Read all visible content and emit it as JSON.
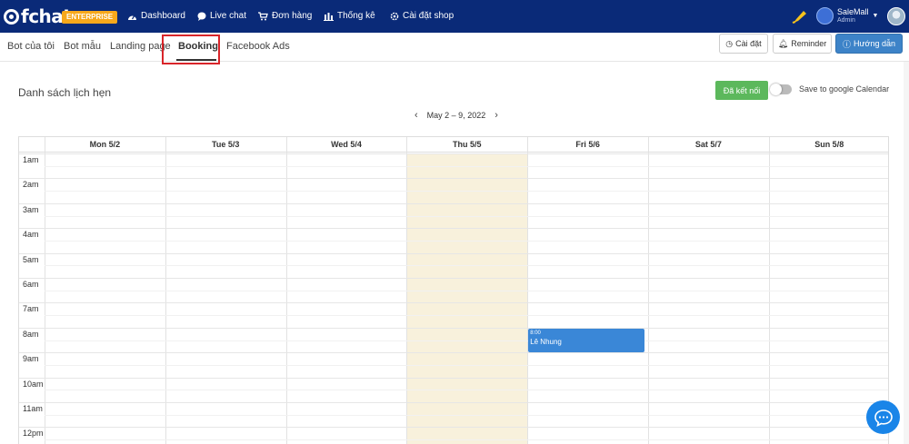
{
  "topbar": {
    "logo": "fchat",
    "badge": "ENTERPRISE",
    "nav": [
      {
        "label": "Dashboard",
        "icon": "dashboard-icon"
      },
      {
        "label": "Live chat",
        "icon": "chat-bubble-icon"
      },
      {
        "label": "Đơn hàng",
        "icon": "cart-icon"
      },
      {
        "label": "Thống kê",
        "icon": "bar-chart-icon"
      },
      {
        "label": "Cài đặt shop",
        "icon": "gear-icon"
      }
    ],
    "user": {
      "name": "SaleMall",
      "role": "Admin"
    }
  },
  "subnav": {
    "tabs": [
      "Bot của tôi",
      "Bot mẫu",
      "Landing page",
      "Booking",
      "Facebook Ads"
    ],
    "active_tab": "Booking",
    "buttons": {
      "settings": "Cài đặt",
      "reminder": "Reminder",
      "guide": "Hướng dẫn"
    }
  },
  "main": {
    "title": "Danh sách lịch hẹn",
    "connected_button": "Đã kết nối",
    "save_to_calendar": "Save to google Calendar",
    "save_to_calendar_on": false,
    "date_range": "May 2 – 9, 2022",
    "days": [
      "Mon 5/2",
      "Tue 5/3",
      "Wed 5/4",
      "Thu 5/5",
      "Fri 5/6",
      "Sat 5/7",
      "Sun 5/8"
    ],
    "hours": [
      "1am",
      "2am",
      "3am",
      "4am",
      "5am",
      "6am",
      "7am",
      "8am",
      "9am",
      "10am",
      "11am",
      "12pm"
    ],
    "event": {
      "time": "8:00",
      "name": "Lê Nhung",
      "day": "Fri 5/6"
    },
    "today": "Thu 5/5"
  },
  "colors": {
    "topbar": "#0a2a78",
    "badge": "#f7a81b",
    "primary": "#3d83c8",
    "success": "#5cb85c",
    "today": "#f8f1dc",
    "event": "#3a87d7",
    "highlight": "#d9252a"
  }
}
